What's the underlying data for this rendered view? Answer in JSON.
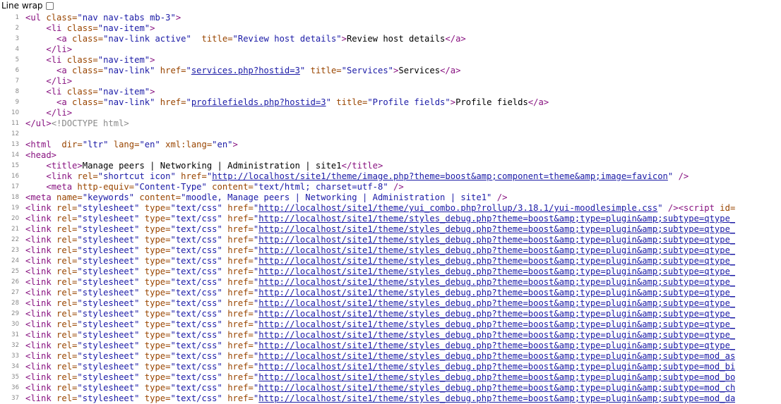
{
  "toolbar": {
    "line_wrap_label": "Line wrap",
    "line_wrap_checked": false
  },
  "lines": [
    {
      "n": "1",
      "indent": "",
      "tokens": [
        [
          "tag",
          "<ul "
        ],
        [
          "an",
          "class="
        ],
        [
          "av",
          "\"nav nav-tabs mb-3\""
        ],
        [
          "tag",
          ">"
        ]
      ]
    },
    {
      "n": "2",
      "indent": "    ",
      "tokens": [
        [
          "tag",
          "<li "
        ],
        [
          "an",
          "class="
        ],
        [
          "av",
          "\"nav-item\""
        ],
        [
          "tag",
          ">"
        ]
      ]
    },
    {
      "n": "3",
      "indent": "      ",
      "tokens": [
        [
          "tag",
          "<a "
        ],
        [
          "an",
          "class="
        ],
        [
          "av",
          "\"nav-link active\""
        ],
        [
          "an",
          "  title="
        ],
        [
          "av",
          "\"Review host details\""
        ],
        [
          "tag",
          ">"
        ],
        [
          "tx",
          "Review host details"
        ],
        [
          "tag",
          "</a>"
        ]
      ]
    },
    {
      "n": "4",
      "indent": "    ",
      "tokens": [
        [
          "tag",
          "</li>"
        ]
      ]
    },
    {
      "n": "5",
      "indent": "    ",
      "tokens": [
        [
          "tag",
          "<li "
        ],
        [
          "an",
          "class="
        ],
        [
          "av",
          "\"nav-item\""
        ],
        [
          "tag",
          ">"
        ]
      ]
    },
    {
      "n": "6",
      "indent": "      ",
      "tokens": [
        [
          "tag",
          "<a "
        ],
        [
          "an",
          "class="
        ],
        [
          "av",
          "\"nav-link\""
        ],
        [
          "an",
          " href="
        ],
        [
          "av",
          "\""
        ],
        [
          "lk",
          "services.php?hostid=3"
        ],
        [
          "av",
          "\""
        ],
        [
          "an",
          " title="
        ],
        [
          "av",
          "\"Services\""
        ],
        [
          "tag",
          ">"
        ],
        [
          "tx",
          "Services"
        ],
        [
          "tag",
          "</a>"
        ]
      ]
    },
    {
      "n": "7",
      "indent": "    ",
      "tokens": [
        [
          "tag",
          "</li>"
        ]
      ]
    },
    {
      "n": "8",
      "indent": "    ",
      "tokens": [
        [
          "tag",
          "<li "
        ],
        [
          "an",
          "class="
        ],
        [
          "av",
          "\"nav-item\""
        ],
        [
          "tag",
          ">"
        ]
      ]
    },
    {
      "n": "9",
      "indent": "      ",
      "tokens": [
        [
          "tag",
          "<a "
        ],
        [
          "an",
          "class="
        ],
        [
          "av",
          "\"nav-link\""
        ],
        [
          "an",
          " href="
        ],
        [
          "av",
          "\""
        ],
        [
          "lk",
          "profilefields.php?hostid=3"
        ],
        [
          "av",
          "\""
        ],
        [
          "an",
          " title="
        ],
        [
          "av",
          "\"Profile fields\""
        ],
        [
          "tag",
          ">"
        ],
        [
          "tx",
          "Profile fields"
        ],
        [
          "tag",
          "</a>"
        ]
      ]
    },
    {
      "n": "10",
      "indent": "    ",
      "tokens": [
        [
          "tag",
          "</li>"
        ]
      ]
    },
    {
      "n": "11",
      "indent": "",
      "tokens": [
        [
          "tag",
          "</ul>"
        ],
        [
          "cm",
          "<!DOCTYPE html>"
        ]
      ]
    },
    {
      "n": "12",
      "indent": "",
      "tokens": []
    },
    {
      "n": "13",
      "indent": "",
      "tokens": [
        [
          "tag",
          "<html "
        ],
        [
          "an",
          " dir="
        ],
        [
          "av",
          "\"ltr\""
        ],
        [
          "an",
          " lang="
        ],
        [
          "av",
          "\"en\""
        ],
        [
          "an",
          " xml:lang="
        ],
        [
          "av",
          "\"en\""
        ],
        [
          "tag",
          ">"
        ]
      ]
    },
    {
      "n": "14",
      "indent": "",
      "tokens": [
        [
          "tag",
          "<head>"
        ]
      ]
    },
    {
      "n": "15",
      "indent": "    ",
      "tokens": [
        [
          "tag",
          "<title>"
        ],
        [
          "tx",
          "Manage peers | Networking | Administration | site1"
        ],
        [
          "tag",
          "</title>"
        ]
      ]
    },
    {
      "n": "16",
      "indent": "    ",
      "tokens": [
        [
          "tag",
          "<link "
        ],
        [
          "an",
          "rel="
        ],
        [
          "av",
          "\"shortcut icon\""
        ],
        [
          "an",
          " href="
        ],
        [
          "av",
          "\""
        ],
        [
          "lk",
          "http://localhost/site1/theme/image.php?theme=boost&amp;component=theme&amp;image=favicon"
        ],
        [
          "av",
          "\""
        ],
        [
          "tag",
          " />"
        ]
      ]
    },
    {
      "n": "17",
      "indent": "    ",
      "tokens": [
        [
          "tag",
          "<meta "
        ],
        [
          "an",
          "http-equiv="
        ],
        [
          "av",
          "\"Content-Type\""
        ],
        [
          "an",
          " content="
        ],
        [
          "av",
          "\"text/html; charset=utf-8\""
        ],
        [
          "tag",
          " />"
        ]
      ]
    },
    {
      "n": "18",
      "indent": "",
      "tokens": [
        [
          "tag",
          "<meta "
        ],
        [
          "an",
          "name="
        ],
        [
          "av",
          "\"keywords\""
        ],
        [
          "an",
          " content="
        ],
        [
          "av",
          "\"moodle, Manage peers | Networking | Administration | site1\""
        ],
        [
          "tag",
          " />"
        ]
      ]
    },
    {
      "n": "19",
      "indent": "",
      "tokens": [
        [
          "tag",
          "<link "
        ],
        [
          "an",
          "rel="
        ],
        [
          "av",
          "\"stylesheet\""
        ],
        [
          "an",
          " type="
        ],
        [
          "av",
          "\"text/css\""
        ],
        [
          "an",
          " href="
        ],
        [
          "av",
          "\""
        ],
        [
          "lk",
          "http://localhost/site1/theme/yui_combo.php?rollup/3.18.1/yui-moodlesimple.css"
        ],
        [
          "av",
          "\""
        ],
        [
          "tag",
          " /><script "
        ],
        [
          "an",
          "id="
        ]
      ]
    },
    {
      "n": "20",
      "indent": "",
      "tokens": [
        [
          "tag",
          "<link "
        ],
        [
          "an",
          "rel="
        ],
        [
          "av",
          "\"stylesheet\""
        ],
        [
          "an",
          " type="
        ],
        [
          "av",
          "\"text/css\""
        ],
        [
          "an",
          " href="
        ],
        [
          "av",
          "\""
        ],
        [
          "lk",
          "http://localhost/site1/theme/styles_debug.php?theme=boost&amp;type=plugin&amp;subtype=qtype_"
        ]
      ]
    },
    {
      "n": "21",
      "indent": "",
      "tokens": [
        [
          "tag",
          "<link "
        ],
        [
          "an",
          "rel="
        ],
        [
          "av",
          "\"stylesheet\""
        ],
        [
          "an",
          " type="
        ],
        [
          "av",
          "\"text/css\""
        ],
        [
          "an",
          " href="
        ],
        [
          "av",
          "\""
        ],
        [
          "lk",
          "http://localhost/site1/theme/styles_debug.php?theme=boost&amp;type=plugin&amp;subtype=qtype_"
        ]
      ]
    },
    {
      "n": "22",
      "indent": "",
      "tokens": [
        [
          "tag",
          "<link "
        ],
        [
          "an",
          "rel="
        ],
        [
          "av",
          "\"stylesheet\""
        ],
        [
          "an",
          " type="
        ],
        [
          "av",
          "\"text/css\""
        ],
        [
          "an",
          " href="
        ],
        [
          "av",
          "\""
        ],
        [
          "lk",
          "http://localhost/site1/theme/styles_debug.php?theme=boost&amp;type=plugin&amp;subtype=qtype_"
        ]
      ]
    },
    {
      "n": "23",
      "indent": "",
      "tokens": [
        [
          "tag",
          "<link "
        ],
        [
          "an",
          "rel="
        ],
        [
          "av",
          "\"stylesheet\""
        ],
        [
          "an",
          " type="
        ],
        [
          "av",
          "\"text/css\""
        ],
        [
          "an",
          " href="
        ],
        [
          "av",
          "\""
        ],
        [
          "lk",
          "http://localhost/site1/theme/styles_debug.php?theme=boost&amp;type=plugin&amp;subtype=qtype_"
        ]
      ]
    },
    {
      "n": "24",
      "indent": "",
      "tokens": [
        [
          "tag",
          "<link "
        ],
        [
          "an",
          "rel="
        ],
        [
          "av",
          "\"stylesheet\""
        ],
        [
          "an",
          " type="
        ],
        [
          "av",
          "\"text/css\""
        ],
        [
          "an",
          " href="
        ],
        [
          "av",
          "\""
        ],
        [
          "lk",
          "http://localhost/site1/theme/styles_debug.php?theme=boost&amp;type=plugin&amp;subtype=qtype_"
        ]
      ]
    },
    {
      "n": "25",
      "indent": "",
      "tokens": [
        [
          "tag",
          "<link "
        ],
        [
          "an",
          "rel="
        ],
        [
          "av",
          "\"stylesheet\""
        ],
        [
          "an",
          " type="
        ],
        [
          "av",
          "\"text/css\""
        ],
        [
          "an",
          " href="
        ],
        [
          "av",
          "\""
        ],
        [
          "lk",
          "http://localhost/site1/theme/styles_debug.php?theme=boost&amp;type=plugin&amp;subtype=qtype_"
        ]
      ]
    },
    {
      "n": "26",
      "indent": "",
      "tokens": [
        [
          "tag",
          "<link "
        ],
        [
          "an",
          "rel="
        ],
        [
          "av",
          "\"stylesheet\""
        ],
        [
          "an",
          " type="
        ],
        [
          "av",
          "\"text/css\""
        ],
        [
          "an",
          " href="
        ],
        [
          "av",
          "\""
        ],
        [
          "lk",
          "http://localhost/site1/theme/styles_debug.php?theme=boost&amp;type=plugin&amp;subtype=qtype_"
        ]
      ]
    },
    {
      "n": "27",
      "indent": "",
      "tokens": [
        [
          "tag",
          "<link "
        ],
        [
          "an",
          "rel="
        ],
        [
          "av",
          "\"stylesheet\""
        ],
        [
          "an",
          " type="
        ],
        [
          "av",
          "\"text/css\""
        ],
        [
          "an",
          " href="
        ],
        [
          "av",
          "\""
        ],
        [
          "lk",
          "http://localhost/site1/theme/styles_debug.php?theme=boost&amp;type=plugin&amp;subtype=qtype_"
        ]
      ]
    },
    {
      "n": "28",
      "indent": "",
      "tokens": [
        [
          "tag",
          "<link "
        ],
        [
          "an",
          "rel="
        ],
        [
          "av",
          "\"stylesheet\""
        ],
        [
          "an",
          " type="
        ],
        [
          "av",
          "\"text/css\""
        ],
        [
          "an",
          " href="
        ],
        [
          "av",
          "\""
        ],
        [
          "lk",
          "http://localhost/site1/theme/styles_debug.php?theme=boost&amp;type=plugin&amp;subtype=qtype_"
        ]
      ]
    },
    {
      "n": "29",
      "indent": "",
      "tokens": [
        [
          "tag",
          "<link "
        ],
        [
          "an",
          "rel="
        ],
        [
          "av",
          "\"stylesheet\""
        ],
        [
          "an",
          " type="
        ],
        [
          "av",
          "\"text/css\""
        ],
        [
          "an",
          " href="
        ],
        [
          "av",
          "\""
        ],
        [
          "lk",
          "http://localhost/site1/theme/styles_debug.php?theme=boost&amp;type=plugin&amp;subtype=qtype_"
        ]
      ]
    },
    {
      "n": "30",
      "indent": "",
      "tokens": [
        [
          "tag",
          "<link "
        ],
        [
          "an",
          "rel="
        ],
        [
          "av",
          "\"stylesheet\""
        ],
        [
          "an",
          " type="
        ],
        [
          "av",
          "\"text/css\""
        ],
        [
          "an",
          " href="
        ],
        [
          "av",
          "\""
        ],
        [
          "lk",
          "http://localhost/site1/theme/styles_debug.php?theme=boost&amp;type=plugin&amp;subtype=qtype_"
        ]
      ]
    },
    {
      "n": "31",
      "indent": "",
      "tokens": [
        [
          "tag",
          "<link "
        ],
        [
          "an",
          "rel="
        ],
        [
          "av",
          "\"stylesheet\""
        ],
        [
          "an",
          " type="
        ],
        [
          "av",
          "\"text/css\""
        ],
        [
          "an",
          " href="
        ],
        [
          "av",
          "\""
        ],
        [
          "lk",
          "http://localhost/site1/theme/styles_debug.php?theme=boost&amp;type=plugin&amp;subtype=qtype_"
        ]
      ]
    },
    {
      "n": "32",
      "indent": "",
      "tokens": [
        [
          "tag",
          "<link "
        ],
        [
          "an",
          "rel="
        ],
        [
          "av",
          "\"stylesheet\""
        ],
        [
          "an",
          " type="
        ],
        [
          "av",
          "\"text/css\""
        ],
        [
          "an",
          " href="
        ],
        [
          "av",
          "\""
        ],
        [
          "lk",
          "http://localhost/site1/theme/styles_debug.php?theme=boost&amp;type=plugin&amp;subtype=qtype_"
        ]
      ]
    },
    {
      "n": "33",
      "indent": "",
      "tokens": [
        [
          "tag",
          "<link "
        ],
        [
          "an",
          "rel="
        ],
        [
          "av",
          "\"stylesheet\""
        ],
        [
          "an",
          " type="
        ],
        [
          "av",
          "\"text/css\""
        ],
        [
          "an",
          " href="
        ],
        [
          "av",
          "\""
        ],
        [
          "lk",
          "http://localhost/site1/theme/styles_debug.php?theme=boost&amp;type=plugin&amp;subtype=mod_as"
        ]
      ]
    },
    {
      "n": "34",
      "indent": "",
      "tokens": [
        [
          "tag",
          "<link "
        ],
        [
          "an",
          "rel="
        ],
        [
          "av",
          "\"stylesheet\""
        ],
        [
          "an",
          " type="
        ],
        [
          "av",
          "\"text/css\""
        ],
        [
          "an",
          " href="
        ],
        [
          "av",
          "\""
        ],
        [
          "lk",
          "http://localhost/site1/theme/styles_debug.php?theme=boost&amp;type=plugin&amp;subtype=mod_bi"
        ]
      ]
    },
    {
      "n": "35",
      "indent": "",
      "tokens": [
        [
          "tag",
          "<link "
        ],
        [
          "an",
          "rel="
        ],
        [
          "av",
          "\"stylesheet\""
        ],
        [
          "an",
          " type="
        ],
        [
          "av",
          "\"text/css\""
        ],
        [
          "an",
          " href="
        ],
        [
          "av",
          "\""
        ],
        [
          "lk",
          "http://localhost/site1/theme/styles_debug.php?theme=boost&amp;type=plugin&amp;subtype=mod_bo"
        ]
      ]
    },
    {
      "n": "36",
      "indent": "",
      "tokens": [
        [
          "tag",
          "<link "
        ],
        [
          "an",
          "rel="
        ],
        [
          "av",
          "\"stylesheet\""
        ],
        [
          "an",
          " type="
        ],
        [
          "av",
          "\"text/css\""
        ],
        [
          "an",
          " href="
        ],
        [
          "av",
          "\""
        ],
        [
          "lk",
          "http://localhost/site1/theme/styles_debug.php?theme=boost&amp;type=plugin&amp;subtype=mod_ch"
        ]
      ]
    },
    {
      "n": "37",
      "indent": "",
      "tokens": [
        [
          "tag",
          "<link "
        ],
        [
          "an",
          "rel="
        ],
        [
          "av",
          "\"stylesheet\""
        ],
        [
          "an",
          " type="
        ],
        [
          "av",
          "\"text/css\""
        ],
        [
          "an",
          " href="
        ],
        [
          "av",
          "\""
        ],
        [
          "lk",
          "http://localhost/site1/theme/styles_debug.php?theme=boost&amp;type=plugin&amp;subtype=mod_da"
        ]
      ]
    }
  ]
}
